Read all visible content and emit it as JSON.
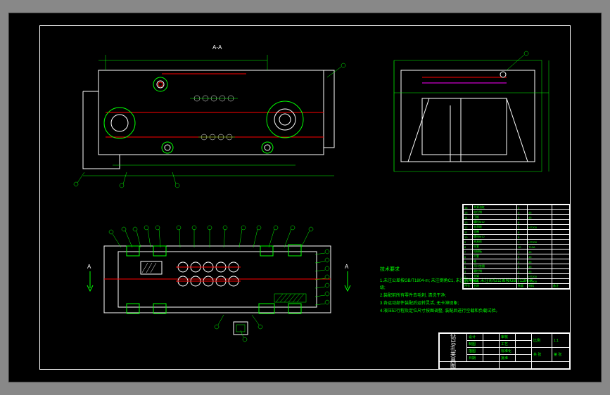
{
  "views": {
    "section_aa": {
      "label": "A-A"
    },
    "plan": {
      "arrow_label": "A"
    }
  },
  "notes": {
    "title": "技术要求",
    "lines": [
      "1.未注公差按GB/T1804-m; 未注倒角C1, 未注圆角R3, 未注形位公差按GB/T1184-K级;",
      "2.装配前所有零件去毛刺, 清洗干净;",
      "3.各运动部件装配后运转灵活, 无卡滞现象;",
      "4.液压缸行程及定位尺寸按图调整, 装配后进行空载和负载试验。"
    ]
  },
  "parts_header": {
    "no": "序号",
    "name": "名称",
    "qty": "数量",
    "mat": "材料",
    "note": "备注"
  },
  "parts": [
    {
      "no": "16",
      "name": "夹紧油缸",
      "qty": "2",
      "mat": ""
    },
    {
      "no": "15",
      "name": "定位销",
      "qty": "4",
      "mat": "45"
    },
    {
      "no": "14",
      "name": "压板",
      "qty": "4",
      "mat": "45"
    },
    {
      "no": "13",
      "name": "螺栓M12",
      "qty": "8",
      "mat": ""
    },
    {
      "no": "12",
      "name": "支承板",
      "qty": "2",
      "mat": "HT200"
    },
    {
      "no": "11",
      "name": "垫圈",
      "qty": "8",
      "mat": ""
    },
    {
      "no": "10",
      "name": "螺母M12",
      "qty": "8",
      "mat": ""
    },
    {
      "no": "9",
      "name": "夹具体",
      "qty": "1",
      "mat": "HT200"
    },
    {
      "no": "8",
      "name": "钻套",
      "qty": "10",
      "mat": "T10A"
    },
    {
      "no": "7",
      "name": "钻模板",
      "qty": "1",
      "mat": "45"
    },
    {
      "no": "6",
      "name": "衬套",
      "qty": "2",
      "mat": "45"
    },
    {
      "no": "5",
      "name": "轴",
      "qty": "2",
      "mat": "45"
    },
    {
      "no": "4",
      "name": "开口垫圈",
      "qty": "2",
      "mat": "45"
    },
    {
      "no": "3",
      "name": "圆柱销",
      "qty": "2",
      "mat": "45"
    },
    {
      "no": "2",
      "name": "支架",
      "qty": "2",
      "mat": "HT200"
    },
    {
      "no": "1",
      "name": "底板",
      "qty": "1",
      "mat": "HT200"
    }
  ],
  "title_block": {
    "drawing_title": "钻10孔夹具图",
    "scale_label": "比例",
    "scale": "1:1",
    "sheet_label": "共 张",
    "sheet": "第 张",
    "rows": [
      [
        "设计",
        "",
        "审核",
        ""
      ],
      [
        "制图",
        "",
        "工艺",
        ""
      ],
      [
        "描图",
        "",
        "标准化",
        ""
      ],
      [
        "日期",
        "",
        "批准",
        ""
      ]
    ],
    "bottom": [
      "",
      "",
      ""
    ]
  }
}
